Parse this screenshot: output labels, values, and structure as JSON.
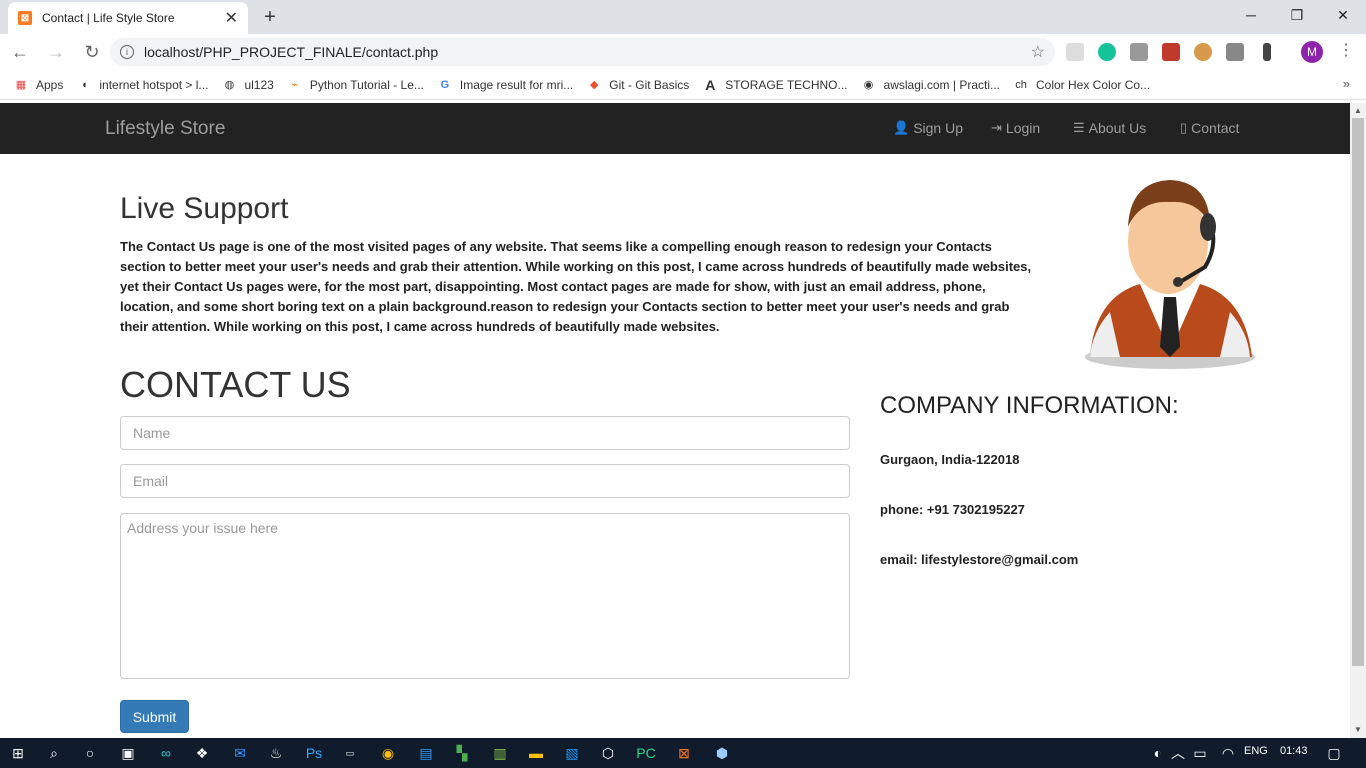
{
  "browser": {
    "tab_title": "Contact | Life Style Store",
    "url": "localhost/PHP_PROJECT_FINALE/contact.php",
    "profile_initial": "M",
    "bookmarks": [
      {
        "label": "Apps",
        "icon": "apps-grid-icon"
      },
      {
        "label": "internet hotspot > l...",
        "icon": "hotspot-icon"
      },
      {
        "label": "ul123",
        "icon": "globe-icon"
      },
      {
        "label": "Python Tutorial - Le...",
        "icon": "python-icon"
      },
      {
        "label": "Image result for mri...",
        "icon": "google-icon"
      },
      {
        "label": "Git - Git Basics",
        "icon": "git-icon"
      },
      {
        "label": "STORAGE TECHNO...",
        "icon": "a-letter-icon"
      },
      {
        "label": "awslagi.com | Practi...",
        "icon": "circle-icon"
      },
      {
        "label": "Color Hex Color Co...",
        "icon": "ch-icon"
      }
    ]
  },
  "navbar": {
    "brand": "Lifestyle Store",
    "links": [
      {
        "label": "Sign Up",
        "icon": "user-icon"
      },
      {
        "label": "Login",
        "icon": "login-icon"
      },
      {
        "label": "About Us",
        "icon": "list-icon"
      },
      {
        "label": "Contact",
        "icon": "phone-icon"
      }
    ]
  },
  "live_support": {
    "title": "Live Support",
    "text": "The Contact Us page is one of the most visited pages of any website. That seems like a compelling enough reason to redesign your Contacts section to better meet your user's needs and grab their attention. While working on this post, I came across hundreds of beautifully made websites, yet their Contact Us pages were, for the most part, disappointing. Most contact pages are made for show, with just an email address, phone, location, and some short boring text on a plain background.reason to redesign your Contacts section to better meet your user's needs and grab their attention. While working on this post, I came across hundreds of beautifully made websites."
  },
  "contact_form": {
    "title": "CONTACT US",
    "name_placeholder": "Name",
    "email_placeholder": "Email",
    "issue_placeholder": "Address your issue here",
    "submit_label": "Submit"
  },
  "company": {
    "title": "COMPANY INFORMATION:",
    "address": "Gurgaon, India-122018",
    "phone": "phone: +91 7302195227",
    "email": "email: lifestylestore@gmail.com"
  },
  "taskbar": {
    "language": "ENG",
    "time": "01:43"
  }
}
